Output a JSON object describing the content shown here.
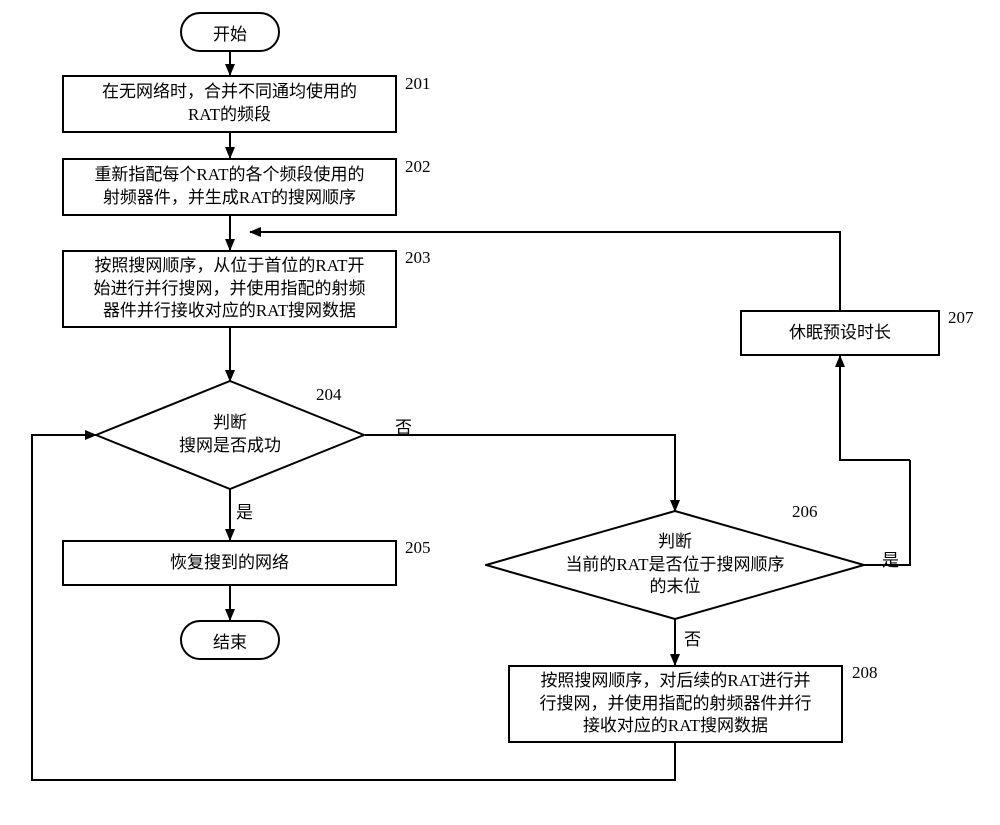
{
  "chart_data": {
    "type": "flowchart",
    "nodes": [
      {
        "id": "start",
        "type": "terminator",
        "text": "开始"
      },
      {
        "id": "201",
        "type": "process",
        "label": "201",
        "text": "在无网络时，合并不同通均使用的RAT的频段"
      },
      {
        "id": "202",
        "type": "process",
        "label": "202",
        "text": "重新指配每个RAT的各个频段使用的射频器件，并生成RAT的搜网顺序"
      },
      {
        "id": "203",
        "type": "process",
        "label": "203",
        "text": "按照搜网顺序，从位于首位的RAT开始进行并行搜网，并使用指配的射频器件并行接收对应的RAT搜网数据"
      },
      {
        "id": "204",
        "type": "decision",
        "label": "204",
        "text": "判断搜网是否成功"
      },
      {
        "id": "205",
        "type": "process",
        "label": "205",
        "text": "恢复搜到的网络"
      },
      {
        "id": "end",
        "type": "terminator",
        "text": "结束"
      },
      {
        "id": "206",
        "type": "decision",
        "label": "206",
        "text": "判断当前的RAT是否位于搜网顺序的末位"
      },
      {
        "id": "207",
        "type": "process",
        "label": "207",
        "text": "休眠预设时长"
      },
      {
        "id": "208",
        "type": "process",
        "label": "208",
        "text": "按照搜网顺序，对后续的RAT进行并行搜网，并使用指配的射频器件并行接收对应的RAT搜网数据"
      }
    ],
    "edges": [
      {
        "from": "start",
        "to": "201"
      },
      {
        "from": "201",
        "to": "202"
      },
      {
        "from": "202",
        "to": "203"
      },
      {
        "from": "203",
        "to": "204"
      },
      {
        "from": "204",
        "to": "205",
        "label": "是"
      },
      {
        "from": "204",
        "to": "206",
        "label": "否"
      },
      {
        "from": "205",
        "to": "end"
      },
      {
        "from": "206",
        "to": "207",
        "label": "是"
      },
      {
        "from": "206",
        "to": "208",
        "label": "否"
      },
      {
        "from": "207",
        "to": "203"
      },
      {
        "from": "208",
        "to": "204"
      }
    ]
  },
  "start": "开始",
  "end": "结束",
  "n201": {
    "label": "201",
    "text": "在无网络时，合并不同通均使用的\nRAT的频段"
  },
  "n202": {
    "label": "202",
    "text": "重新指配每个RAT的各个频段使用的\n射频器件，并生成RAT的搜网顺序"
  },
  "n203": {
    "label": "203",
    "text": "按照搜网顺序，从位于首位的RAT开\n始进行并行搜网，并使用指配的射频\n器件并行接收对应的RAT搜网数据"
  },
  "n204": {
    "label": "204",
    "text": "判断\n搜网是否成功"
  },
  "n205": {
    "label": "205",
    "text": "恢复搜到的网络"
  },
  "n206": {
    "label": "206",
    "text": "判断\n当前的RAT是否位于搜网顺序\n的末位"
  },
  "n207": {
    "label": "207",
    "text": "休眠预设时长"
  },
  "n208": {
    "label": "208",
    "text": "按照搜网顺序，对后续的RAT进行并\n行搜网，并使用指配的射频器件并行\n接收对应的RAT搜网数据"
  },
  "yes": "是",
  "no": "否"
}
